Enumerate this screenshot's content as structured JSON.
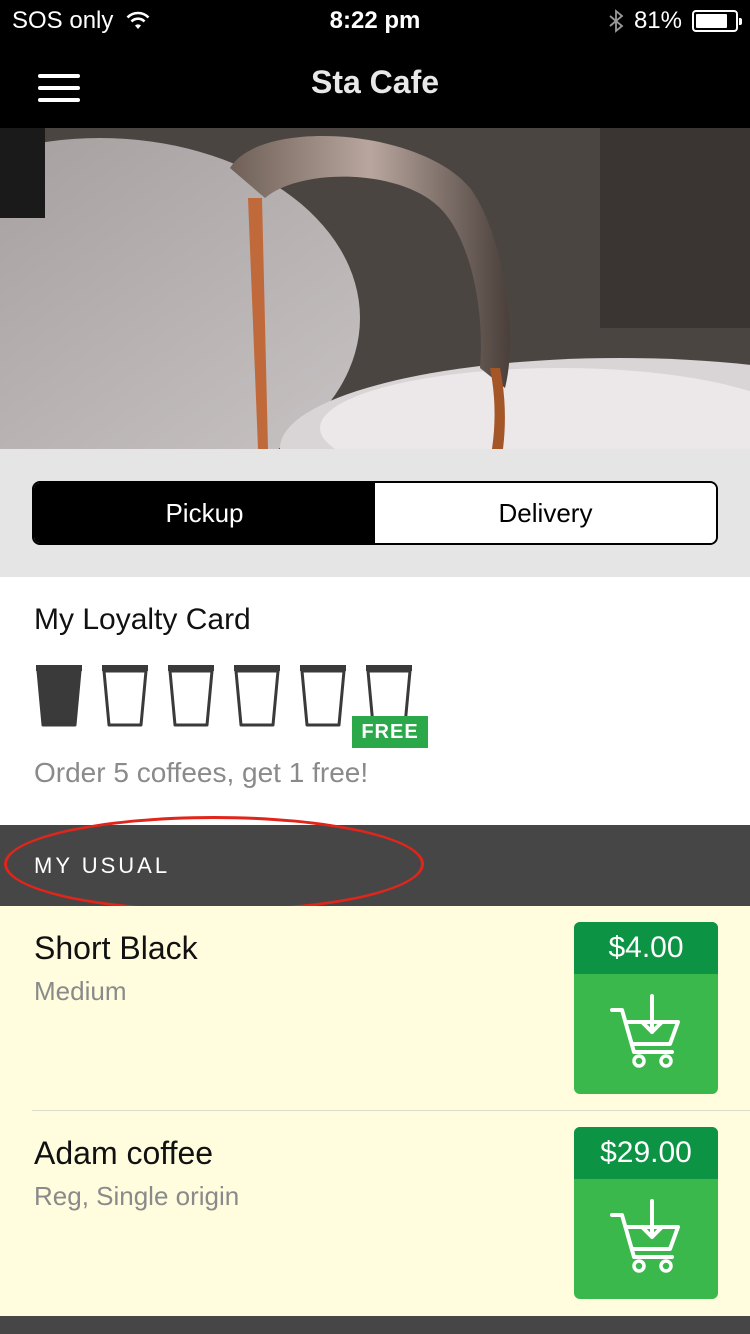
{
  "status_bar": {
    "carrier": "SOS only",
    "time": "8:22 pm",
    "battery_percent": "81%",
    "battery_level": 0.81,
    "icons": [
      "wifi-icon",
      "bluetooth-icon",
      "battery-icon"
    ]
  },
  "nav": {
    "title": "Sta Cafe",
    "menu_icon": "hamburger-menu-icon"
  },
  "hero": {
    "image": "espresso-pouring-photo"
  },
  "order_mode": {
    "options": [
      "Pickup",
      "Delivery"
    ],
    "selected": "Pickup"
  },
  "loyalty": {
    "title": "My Loyalty Card",
    "stamps_filled": 1,
    "stamps_total": 5,
    "free_label": "FREE",
    "note": "Order 5 coffees, get 1 free!"
  },
  "usual": {
    "header": "MY USUAL",
    "items": [
      {
        "name": "Short Black",
        "options": "Medium",
        "price": "$4.00"
      },
      {
        "name": "Adam coffee",
        "options": "Reg, Single origin",
        "price": "$29.00"
      }
    ]
  },
  "colors": {
    "accent_green": "#3bb84c",
    "price_green": "#0c9444",
    "header_dark": "#464646",
    "usual_background": "#fffdde",
    "highlight_red": "#e1251b"
  }
}
